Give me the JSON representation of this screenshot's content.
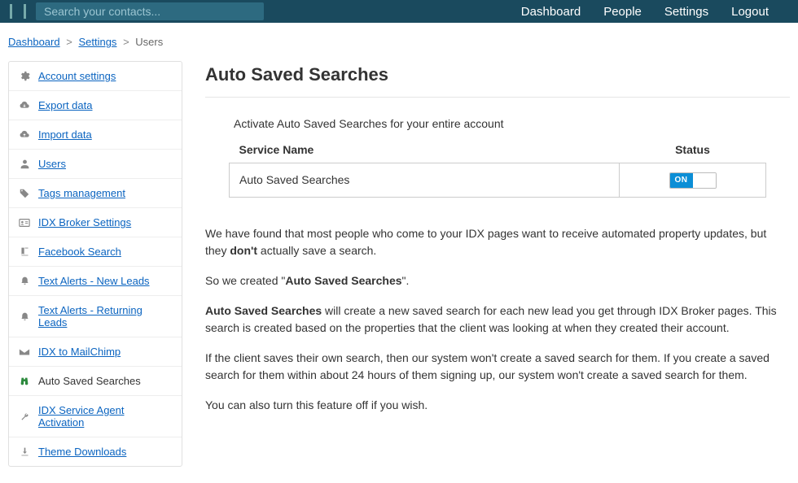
{
  "search": {
    "placeholder": "Search your contacts..."
  },
  "nav": {
    "dashboard": "Dashboard",
    "people": "People",
    "settings": "Settings",
    "logout": "Logout"
  },
  "breadcrumb": {
    "dashboard": "Dashboard",
    "settings": "Settings",
    "users": "Users"
  },
  "sidebar": {
    "items": [
      {
        "label": "Account settings"
      },
      {
        "label": "Export data"
      },
      {
        "label": "Import data"
      },
      {
        "label": "Users"
      },
      {
        "label": "Tags management"
      },
      {
        "label": "IDX Broker Settings"
      },
      {
        "label": "Facebook Search"
      },
      {
        "label": "Text Alerts - New Leads"
      },
      {
        "label": "Text Alerts - Returning Leads"
      },
      {
        "label": "IDX to MailChimp"
      },
      {
        "label": "Auto Saved Searches"
      },
      {
        "label": "IDX Service Agent Activation"
      },
      {
        "label": "Theme Downloads"
      }
    ]
  },
  "page": {
    "title": "Auto Saved Searches",
    "activate_label": "Activate Auto Saved Searches for your entire account",
    "col_service": "Service Name",
    "col_status": "Status",
    "row_service": "Auto Saved Searches",
    "toggle_on": "ON",
    "p1a": "We have found that most people who come to your IDX pages want to receive automated property updates, but they ",
    "p1b": "don't",
    "p1c": " actually save a search.",
    "p2a": "So we created \"",
    "p2b": "Auto Saved Searches",
    "p2c": "\".",
    "p3b": "Auto Saved Searches",
    "p3c": " will create a new saved search for each new lead you get through IDX Broker pages. This search is created based on the properties that the client was looking at when they created their account.",
    "p4": "If the client saves their own search, then our system won't create a saved search for them. If you create a saved search for them within about 24 hours of them signing up, our system won't create a saved search for them.",
    "p5": "You can also turn this feature off if you wish."
  }
}
